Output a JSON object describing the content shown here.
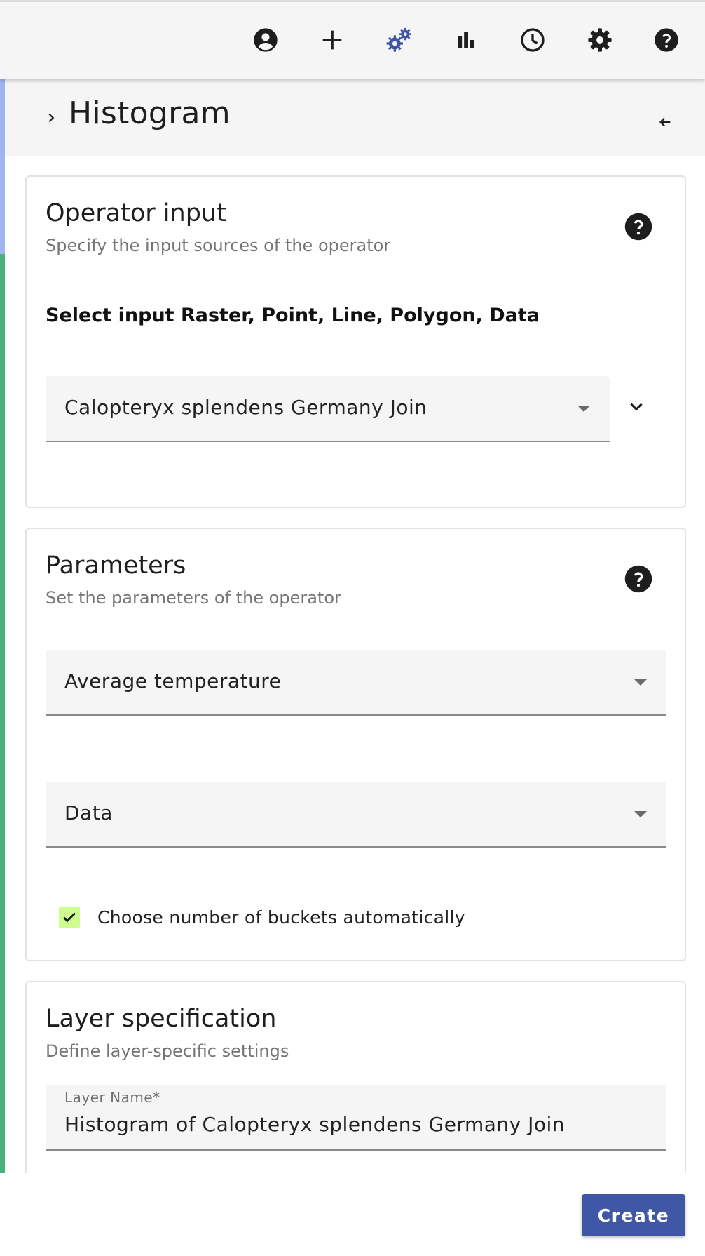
{
  "toolbar": {
    "buttons": [
      {
        "name": "account-icon"
      },
      {
        "name": "add-icon"
      },
      {
        "name": "operators-icon",
        "active_color": "#3f57a4"
      },
      {
        "name": "chart-icon"
      },
      {
        "name": "history-icon"
      },
      {
        "name": "settings-icon"
      },
      {
        "name": "help-icon"
      }
    ]
  },
  "panel": {
    "title": "Histogram"
  },
  "operator_input": {
    "title": "Operator input",
    "subtitle": "Specify the input sources of the operator",
    "select_label": "Select input Raster, Point, Line, Polygon, Data",
    "selected_source": "Calopteryx splendens Germany Join"
  },
  "parameters": {
    "title": "Parameters",
    "subtitle": "Set the parameters of the operator",
    "attribute_value": "Average temperature",
    "bounds_value": "Data",
    "auto_buckets_label": "Choose number of buckets automatically",
    "auto_buckets_checked": true
  },
  "layer_spec": {
    "title": "Layer specification",
    "subtitle": "Define layer-specific settings",
    "name_label": "Layer Name*",
    "name_value": "Histogram of Calopteryx splendens Germany Join"
  },
  "actions": {
    "create_label": "Create"
  },
  "colors": {
    "accent": "#3f57a4",
    "checkbox_fill": "#ccff90"
  }
}
